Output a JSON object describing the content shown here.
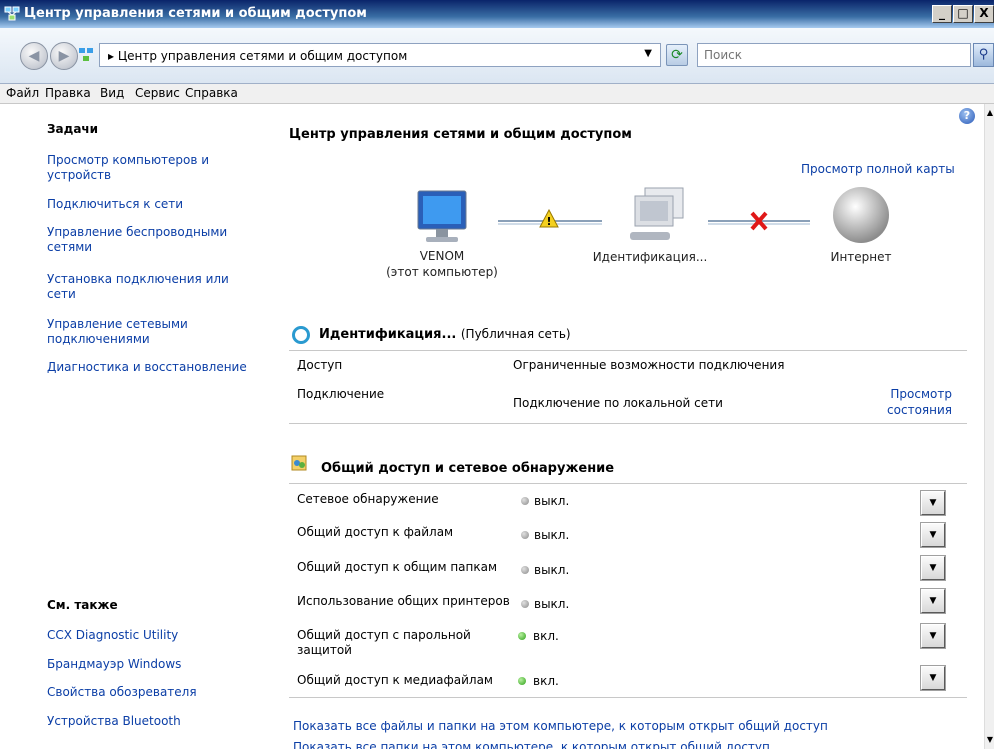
{
  "window": {
    "title": "Центр управления сетями и общим доступом",
    "min": "_",
    "max": "□",
    "close": "X"
  },
  "address": {
    "breadcrumb": "▸ Центр управления сетями и общим доступом",
    "search_placeholder": "Поиск"
  },
  "menu": [
    "Файл",
    "Правка",
    "Вид",
    "Сервис",
    "Справка"
  ],
  "sidebar": {
    "tasks_heading": "Задачи",
    "tasks": [
      "Просмотр компьютеров и устройств",
      "Подключиться к сети",
      "Управление беспроводными сетями",
      "Установка подключения или сети",
      "Управление сетевыми подключениями",
      "Диагностика и восстановление"
    ],
    "see_also_heading": "См. также",
    "see_also": [
      "CCX Diagnostic Utility",
      "Брандмауэр Windows",
      "Свойства обозревателя",
      "Устройства Bluetooth"
    ]
  },
  "page": {
    "title": "Центр управления сетями и общим доступом",
    "full_map_link": "Просмотр полной карты"
  },
  "netmap": {
    "computer_name": "VENOM",
    "computer_sub": "(этот компьютер)",
    "network": "Идентификация...",
    "internet": "Интернет"
  },
  "network_section": {
    "name": "Идентификация...",
    "type": "(Публичная сеть)",
    "rows": [
      {
        "label": "Доступ",
        "value": "Ограниченные возможности подключения"
      },
      {
        "label": "Подключение",
        "value": "Подключение по локальной сети",
        "link1": "Просмотр",
        "link2": "состояния"
      }
    ]
  },
  "sharing": {
    "heading": "Общий доступ и сетевое обнаружение",
    "rows": [
      {
        "label": "Сетевое обнаружение",
        "state": "выкл.",
        "on": false
      },
      {
        "label": "Общий доступ к файлам",
        "state": "выкл.",
        "on": false
      },
      {
        "label": "Общий доступ к общим папкам",
        "state": "выкл.",
        "on": false
      },
      {
        "label": "Использование общих принтеров",
        "state": "выкл.",
        "on": false
      },
      {
        "label": "Общий доступ с парольной",
        "label2": "защитой",
        "state": "вкл.",
        "on": true
      },
      {
        "label": "Общий доступ к медиафайлам",
        "state": "вкл.",
        "on": true
      }
    ]
  },
  "footer": {
    "link1": "Показать все файлы и папки на этом компьютере, к которым открыт общий доступ",
    "link2": "Показать все папки на этом компьютере, к которым открыт общий доступ"
  },
  "colors": {
    "link": "#0b3ea6",
    "title_bar": "#0a246a",
    "on": "#2ca018",
    "off": "#8a8a8a",
    "warning": "#f4d020",
    "error": "#e01818"
  }
}
